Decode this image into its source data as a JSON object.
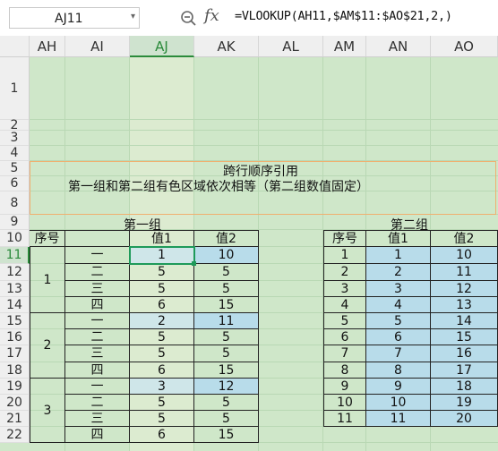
{
  "formula_bar": {
    "name_box": "AJ11",
    "formula": "=VLOOKUP(AH11,$AM$11:$AO$21,2,)",
    "fx_label": "fx"
  },
  "columns": [
    "AH",
    "AI",
    "AJ",
    "AK",
    "AL",
    "AM",
    "AN",
    "AO"
  ],
  "rows": [
    "1",
    "2",
    "3",
    "4",
    "5",
    "6",
    "8",
    "9",
    "10",
    "11",
    "12",
    "13",
    "14",
    "15",
    "16",
    "17",
    "18",
    "19",
    "20",
    "21",
    "22"
  ],
  "sheet": {
    "title": "跨行顺序引用",
    "subtitle": "第一组和第二组有色区域依次相等（第二组数值固定）",
    "group1_title": "第一组",
    "group2_title": "第二组"
  },
  "table1": {
    "headers": [
      "序号",
      "",
      "值1",
      "值2"
    ],
    "groups": [
      "1",
      "2",
      "3"
    ],
    "rows": [
      [
        "一",
        "1",
        "10"
      ],
      [
        "二",
        "5",
        "5"
      ],
      [
        "三",
        "5",
        "5"
      ],
      [
        "四",
        "6",
        "15"
      ],
      [
        "一",
        "2",
        "11"
      ],
      [
        "二",
        "5",
        "5"
      ],
      [
        "三",
        "5",
        "5"
      ],
      [
        "四",
        "6",
        "15"
      ],
      [
        "一",
        "3",
        "12"
      ],
      [
        "二",
        "5",
        "5"
      ],
      [
        "三",
        "5",
        "5"
      ],
      [
        "四",
        "6",
        "15"
      ]
    ]
  },
  "table2": {
    "headers": [
      "序号",
      "值1",
      "值2"
    ],
    "rows": [
      [
        "1",
        "1",
        "10"
      ],
      [
        "2",
        "2",
        "11"
      ],
      [
        "3",
        "3",
        "12"
      ],
      [
        "4",
        "4",
        "13"
      ],
      [
        "5",
        "5",
        "14"
      ],
      [
        "6",
        "6",
        "15"
      ],
      [
        "7",
        "7",
        "16"
      ],
      [
        "8",
        "8",
        "17"
      ],
      [
        "9",
        "9",
        "18"
      ],
      [
        "10",
        "10",
        "19"
      ],
      [
        "11",
        "11",
        "20"
      ]
    ]
  },
  "colors": {
    "sheet_bg": "#cfe7c9",
    "highlight": "#b8dcea",
    "selection": "#1e9a5a",
    "title_border": "#f0b070"
  }
}
